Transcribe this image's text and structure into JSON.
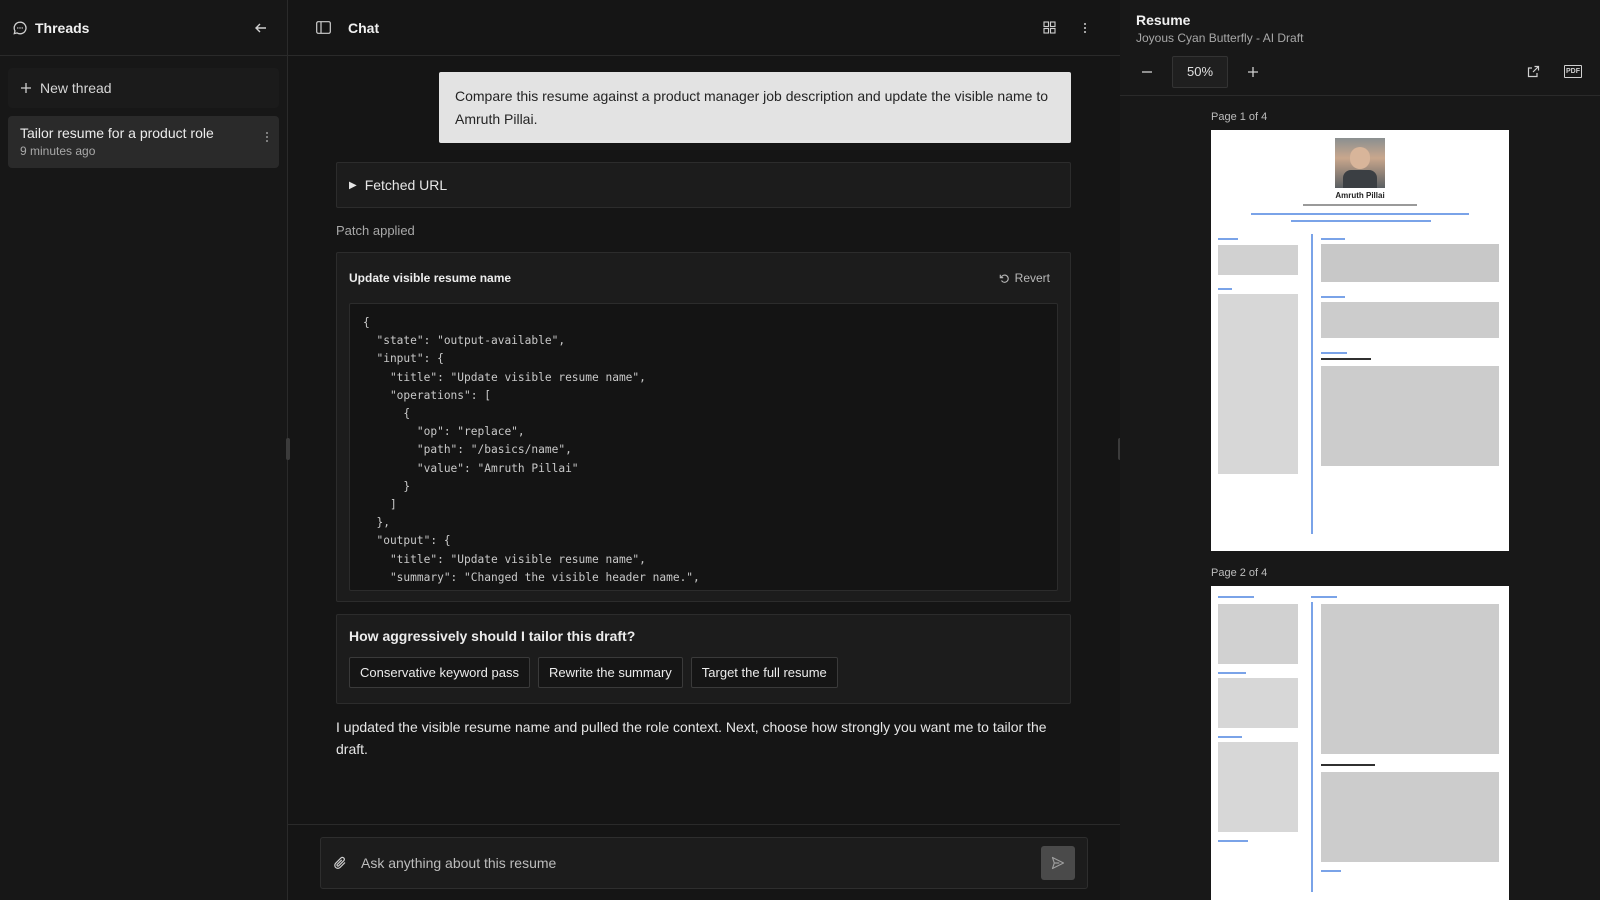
{
  "sidebar": {
    "title": "Threads",
    "new_thread_label": "New thread",
    "threads": [
      {
        "title": "Tailor resume for a product role",
        "time": "9 minutes ago"
      }
    ]
  },
  "chat": {
    "title": "Chat",
    "user_message": "Compare this resume against a product manager job description and update the visible name to Amruth Pillai.",
    "fetched_label": "Fetched URL",
    "patch_label": "Patch applied",
    "patch_card": {
      "title": "Update visible resume name",
      "revert_label": "Revert",
      "code": "{\n  \"state\": \"output-available\",\n  \"input\": {\n    \"title\": \"Update visible resume name\",\n    \"operations\": [\n      {\n        \"op\": \"replace\",\n        \"path\": \"/basics/name\",\n        \"value\": \"Amruth Pillai\"\n      }\n    ]\n  },\n  \"output\": {\n    \"title\": \"Update visible resume name\",\n    \"summary\": \"Changed the visible header name.\","
    },
    "question": {
      "text": "How aggressively should I tailor this draft?",
      "choices": [
        "Conservative keyword pass",
        "Rewrite the summary",
        "Target the full resume"
      ]
    },
    "assistant_message": "I updated the visible resume name and pulled the role context. Next, choose how strongly you want me to tailor the draft.",
    "composer_placeholder": "Ask anything about this resume"
  },
  "resume": {
    "title": "Resume",
    "subtitle": "Joyous Cyan Butterfly - AI Draft",
    "zoom": "50%",
    "pages": [
      {
        "label": "Page 1 of 4",
        "name": "Amruth Pillai"
      },
      {
        "label": "Page 2 of 4"
      }
    ]
  }
}
